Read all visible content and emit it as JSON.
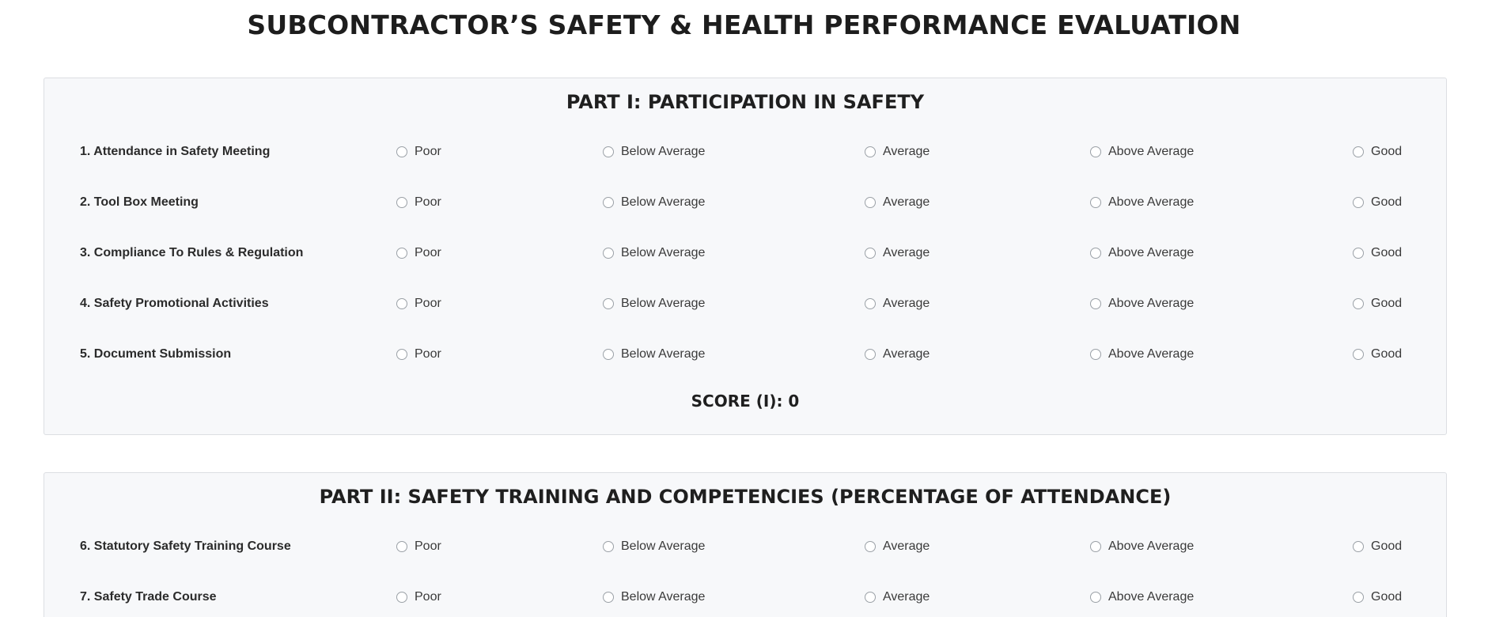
{
  "page_title": "SUBCONTRACTOR’S SAFETY & HEALTH PERFORMANCE EVALUATION",
  "rating_options": [
    "Poor",
    "Below Average",
    "Average",
    "Above Average",
    "Good"
  ],
  "part1": {
    "title": "PART I: PARTICIPATION IN SAFETY",
    "questions": [
      "1. Attendance in Safety Meeting",
      "2. Tool Box Meeting",
      "3. Compliance To Rules & Regulation",
      "4. Safety Promotional Activities",
      "5. Document Submission"
    ],
    "score_text": "SCORE (I): 0"
  },
  "part2": {
    "title": "PART II: SAFETY TRAINING AND COMPETENCIES (PERCENTAGE OF ATTENDANCE)",
    "questions": [
      "6. Statutory Safety Training Course",
      "7. Safety Trade Course"
    ]
  }
}
